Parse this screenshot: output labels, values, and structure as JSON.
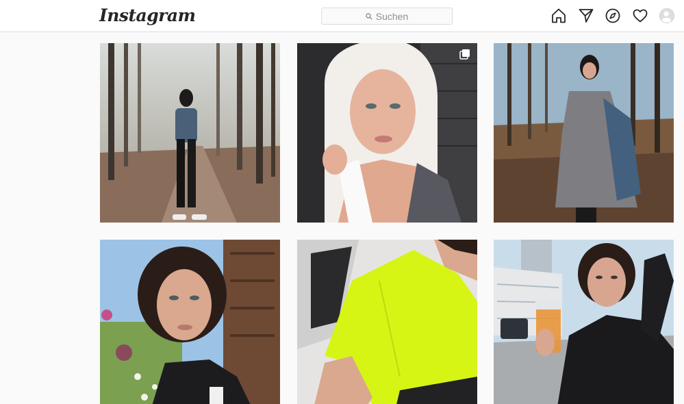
{
  "header": {
    "logo_text": "Instagram",
    "search_placeholder": "Suchen",
    "nav_icons": [
      "home-icon",
      "direct-icon",
      "explore-icon",
      "activity-heart-icon",
      "profile-avatar"
    ]
  },
  "colors": {
    "border": "#dbdbdb",
    "background": "#fafafa",
    "icon": "#262626",
    "muted_text": "#8e8e8e"
  },
  "posts": [
    {
      "row": 1,
      "col": 1,
      "scene": "foggy forest path, woman in denim jacket"
    },
    {
      "row": 1,
      "col": 2,
      "scene": "selfie with white towel, dark wall",
      "multi": true
    },
    {
      "row": 1,
      "col": 3,
      "scene": "woman in grey dress in autumn forest"
    },
    {
      "row": 2,
      "col": 1,
      "scene": "selfie with wildflowers by wooden house"
    },
    {
      "row": 2,
      "col": 2,
      "scene": "neon yellow top, car interior"
    },
    {
      "row": 2,
      "col": 3,
      "scene": "woman with iced drink in city street"
    }
  ]
}
